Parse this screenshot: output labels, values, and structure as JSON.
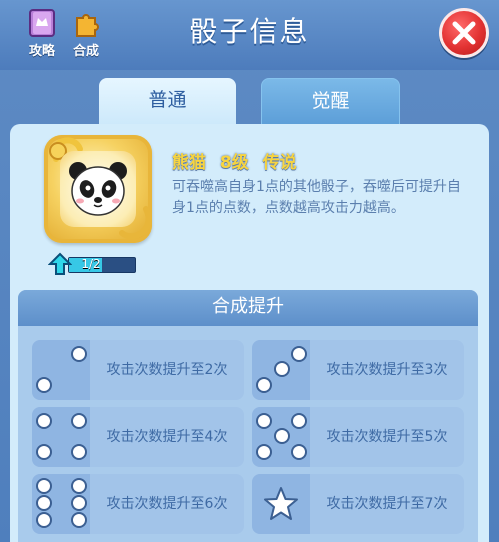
{
  "header": {
    "title": "骰子信息",
    "guide_label": "攻略",
    "compose_label": "合成"
  },
  "tabs": [
    {
      "label": "普通"
    },
    {
      "label": "觉醒"
    }
  ],
  "dice": {
    "name": "熊猫  8级  传说",
    "description": "可吞噬高自身1点的其他骰子，吞噬后可提升自身1点的点数，点数越高攻击力越高。",
    "level_text": "1/2",
    "level_progress": 0.5
  },
  "upgrade": {
    "title": "合成提升",
    "items": [
      {
        "text": "攻击次数提升至2次",
        "pips": 2
      },
      {
        "text": "攻击次数提升至3次",
        "pips": 3
      },
      {
        "text": "攻击次数提升至4次",
        "pips": 4
      },
      {
        "text": "攻击次数提升至5次",
        "pips": 5
      },
      {
        "text": "攻击次数提升至6次",
        "pips": 6
      },
      {
        "text": "攻击次数提升至7次",
        "pips": 7
      }
    ]
  },
  "colors": {
    "accent_gold": "#f7d440",
    "close_red": "#e23232",
    "panel_bg": "#d3ecfb"
  }
}
